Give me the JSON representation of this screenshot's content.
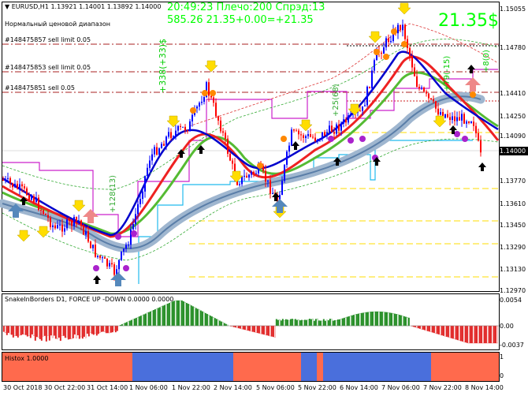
{
  "header": {
    "symbol_line": "EURUSD,H1  1.13921 1.14001 1.13892 1.14000",
    "indicator_name": "Нормальный ценовой диапазон",
    "info_line1": "20:49:23 Плечо:200 Спрэд:13",
    "info_line2": "585.26    21.35+0.00=+21.35",
    "profit_big": "21.35$"
  },
  "orders": [
    {
      "label": "#148475857 sell limit 0.05"
    },
    {
      "label": "#148475853 sell limit 0.05"
    },
    {
      "label": "#148475851 sell 0.05"
    }
  ],
  "price_axis": {
    "labels": [
      "1.15055",
      "1.14780",
      "1.14410",
      "1.14250",
      "1.14090",
      "1.13770",
      "1.13610",
      "1.13450",
      "1.13290",
      "1.13130",
      "1.12970"
    ],
    "current_price": "1.14000"
  },
  "rotated_labels": [
    "+338(+33)$",
    "+128(13)",
    "+25(68)",
    "+79(-15)",
    "+8(0)"
  ],
  "osc_panel": {
    "title": "SnakeInBorders D1, FORCE UP -DOWN  0.0000 0.0000",
    "axis": [
      "0.0054",
      "0.00",
      "-0.0037"
    ]
  },
  "histo_panel": {
    "title": "Histox 1.0000",
    "axis": [
      "1",
      "0"
    ]
  },
  "time_axis": [
    "30 Oct 2018",
    "30 Oct 22:00",
    "31 Oct 14:00",
    "1 Nov 06:00",
    "1 Nov 22:00",
    "2 Nov 14:00",
    "5 Nov 06:00",
    "5 Nov 22:00",
    "6 Nov 14:00",
    "7 Nov 06:00",
    "7 Nov 22:00",
    "8 Nov 14:00"
  ],
  "colors": {
    "bull": "#0000ff",
    "bear": "#ff0000",
    "accent_green": "#00ff00",
    "histo_red": "#ff6a4d",
    "histo_blue": "#4a6fdc"
  }
}
